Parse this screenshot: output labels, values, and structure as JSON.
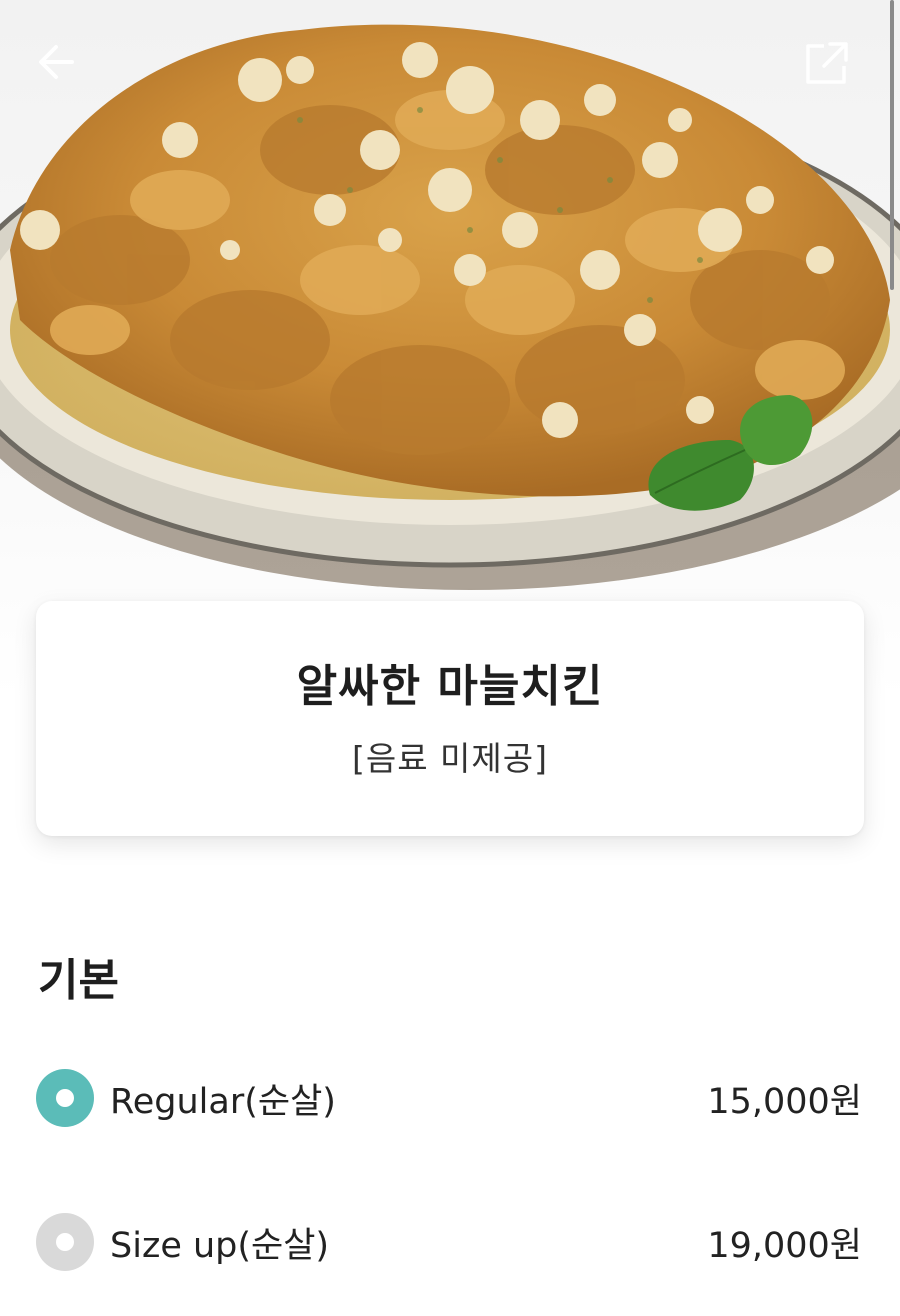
{
  "header": {
    "back_icon": "arrow-left-icon",
    "share_icon": "share-external-icon"
  },
  "hero": {
    "image_subject": "fried chicken with garlic on oval plate with basil garnish"
  },
  "product": {
    "name": "알싸한 마늘치킨",
    "note": "[음료 미제공]"
  },
  "options_section": {
    "title": "기본",
    "items": [
      {
        "label": "Regular(순살)",
        "price": "15,000원",
        "selected": true
      },
      {
        "label": "Size up(순살)",
        "price": "19,000원",
        "selected": false
      }
    ]
  },
  "colors": {
    "accent": "#5bbcb8",
    "radio_unselected": "#d9d9d9"
  }
}
